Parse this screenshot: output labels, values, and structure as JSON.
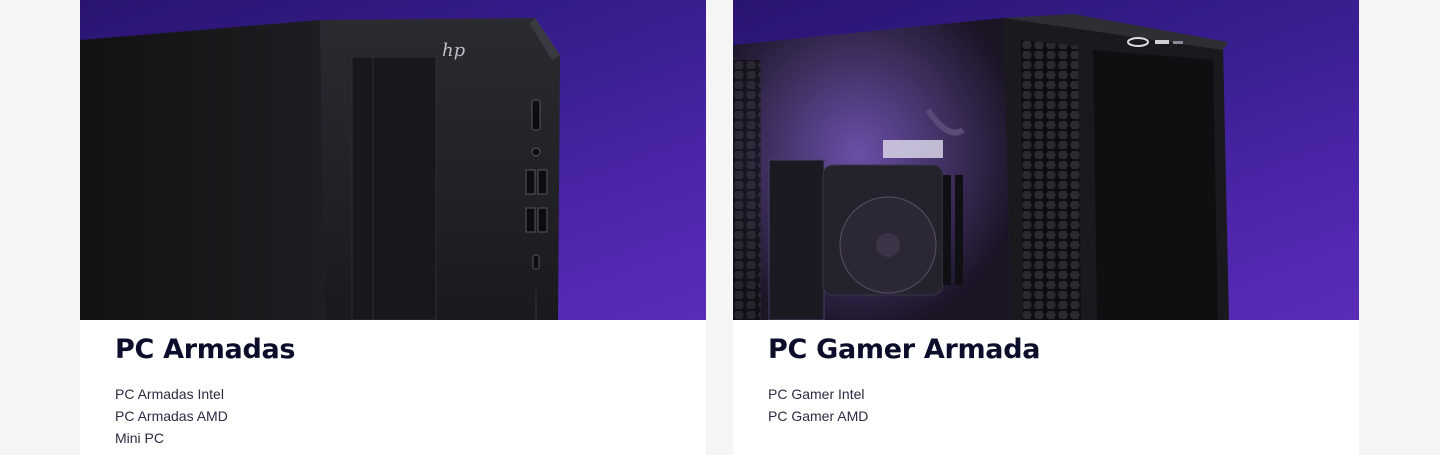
{
  "cards": [
    {
      "title": "PC Armadas",
      "image_alt": "HP tower desktop PC in black",
      "links": [
        "PC Armadas Intel",
        "PC Armadas AMD",
        "Mini PC"
      ]
    },
    {
      "title": "PC Gamer Armada",
      "image_alt": "Gaming PC case with glass side panel and RGB cooler",
      "links": [
        "PC Gamer Intel",
        "PC Gamer AMD"
      ]
    }
  ]
}
